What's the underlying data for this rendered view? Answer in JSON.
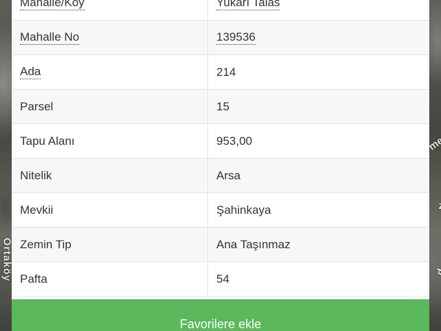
{
  "map": {
    "label_left": "Ortaköy",
    "label_right_1": "me",
    "label_right_2": "z",
    "label_right_3": "d"
  },
  "parcel_info": {
    "rows": [
      {
        "label": "Mahalle/Köy",
        "value": "Yukarı Talas",
        "label_dotted": true,
        "value_dotted": true
      },
      {
        "label": "Mahalle No",
        "value": "139536",
        "label_dotted": true,
        "value_dotted": true
      },
      {
        "label": "Ada",
        "value": "214",
        "label_dotted": true,
        "value_dotted": false
      },
      {
        "label": "Parsel",
        "value": "15",
        "label_dotted": false,
        "value_dotted": false
      },
      {
        "label": "Tapu Alanı",
        "value": "953,00",
        "label_dotted": false,
        "value_dotted": false
      },
      {
        "label": "Nitelik",
        "value": "Arsa",
        "label_dotted": false,
        "value_dotted": false
      },
      {
        "label": "Mevkii",
        "value": "Şahinkaya",
        "label_dotted": false,
        "value_dotted": false
      },
      {
        "label": "Zemin Tip",
        "value": "Ana Taşınmaz",
        "label_dotted": false,
        "value_dotted": false
      },
      {
        "label": "Pafta",
        "value": "54",
        "label_dotted": false,
        "value_dotted": false
      }
    ]
  },
  "actions": {
    "favorite_label": "Favorilere ekle",
    "favorite_color": "#5cb85c"
  }
}
